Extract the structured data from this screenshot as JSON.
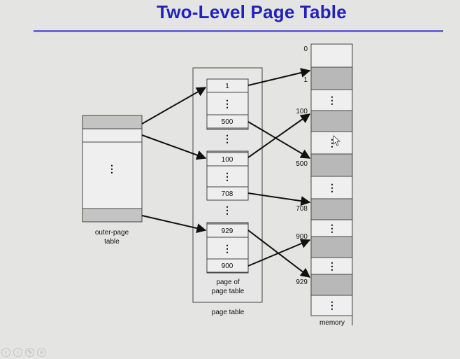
{
  "slide": {
    "title": "Two-Level Page Table"
  },
  "outer_page_table": {
    "caption_line1": "outer-page",
    "caption_line2": "table"
  },
  "page_table": {
    "caption": "page table",
    "inner_caption_line1": "page of",
    "inner_caption_line2": "page table",
    "groups": [
      {
        "entries": [
          "1",
          "500"
        ]
      },
      {
        "entries": [
          "100",
          "708"
        ]
      },
      {
        "entries": [
          "929",
          "900"
        ]
      }
    ]
  },
  "memory": {
    "caption": "memory",
    "addresses": [
      "0",
      "1",
      "100",
      "500",
      "708",
      "900",
      "929"
    ]
  },
  "colors": {
    "title": "#2222bb",
    "rule": "#6a6ad6",
    "shaded_frame": "#b8b8b8",
    "cell_fill": "#eeeeee",
    "arrow": "#111111"
  },
  "icons": [
    "previous-icon",
    "next-icon",
    "pen-icon",
    "menu-icon"
  ]
}
